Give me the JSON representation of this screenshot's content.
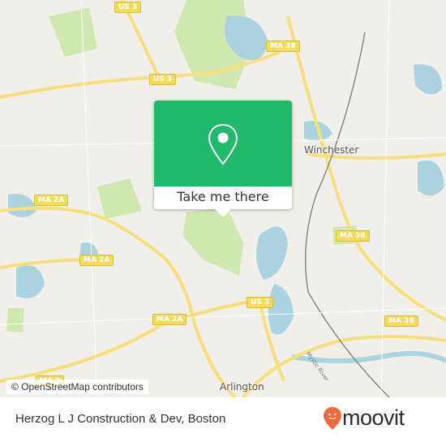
{
  "map": {
    "shields": [
      "US 3",
      "US 3",
      "US 3",
      "MA 38",
      "MA 38",
      "MA 38",
      "MA 2A",
      "MA 2A",
      "MA 2A",
      "MA 2"
    ],
    "places": [
      "Winchester",
      "Arlington"
    ],
    "river": "Mystic River",
    "attribution": "© OpenStreetMap contributors",
    "colors": {
      "land": "#f1efe9",
      "water": "#aad3df",
      "park": "#cfe8b0",
      "road": "#f7e07a"
    }
  },
  "popup": {
    "icon": "map-pin-icon",
    "action_label": "Take me there",
    "color": "#1fba6a"
  },
  "footer": {
    "title": "Herzog L J Construction & Dev, Boston",
    "brand": "moovit",
    "brand_color": "#f06a3c"
  }
}
